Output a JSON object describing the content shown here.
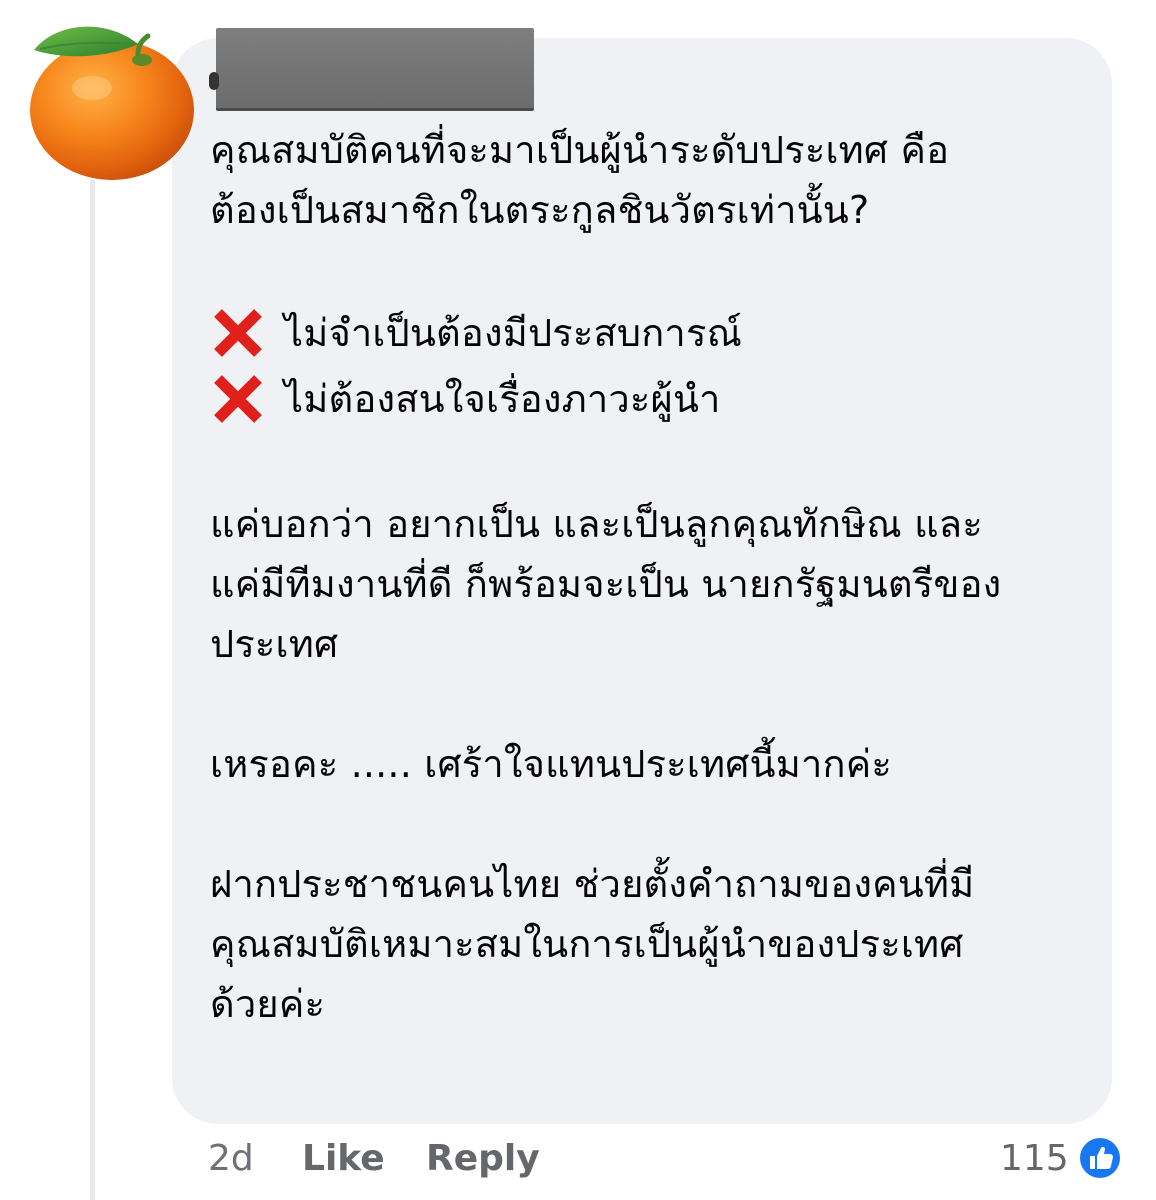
{
  "comment": {
    "lines": {
      "p1_l1": "คุณสมบัติคนที่จะมาเป็นผู้นำระดับประเทศ คือ",
      "p1_l2": "ต้องเป็นสมาชิกในตระกูลชินวัตรเท่านั้น?",
      "x1": "ไม่จำเป็นต้องมีประสบการณ์",
      "x2": "ไม่ต้องสนใจเรื่องภาวะผู้นำ",
      "p3_l1": "แค่บอกว่า อยากเป็น และเป็นลูกคุณทักษิณ และ",
      "p3_l2": "แค่มีทีมงานที่ดี ก็พร้อมจะเป็น นายกรัฐมนตรีของ",
      "p3_l3": "ประเทศ",
      "p4_l1": "เหรอคะ ..... เศร้าใจแทนประเทศนี้มากค่ะ",
      "p5_l1": "ฝากประชาชนคนไทย ช่วยตั้งคำถามของคนที่มี",
      "p5_l2": "คุณสมบัติเหมาะสมในการเป็นผู้นำของประเทศ",
      "p5_l3": "ด้วยค่ะ"
    },
    "x_icon": "cross-mark-icon"
  },
  "footer": {
    "time": "2d",
    "like_label": "Like",
    "reply_label": "Reply",
    "reaction_count": "115",
    "reaction_icon": "thumbs-up-icon"
  },
  "avatar_icon": "tangerine-icon",
  "colors": {
    "bubble": "#f0f1f5",
    "footer_text": "#65676b",
    "reaction_blue": "#1877f2",
    "cross_red": "#e0201b"
  }
}
